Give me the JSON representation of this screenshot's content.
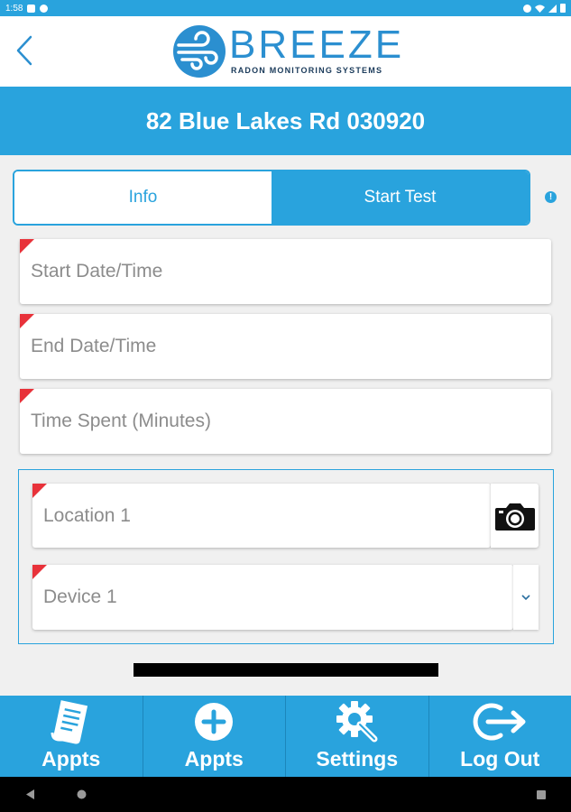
{
  "status_bar": {
    "time": "1:58"
  },
  "header": {
    "logo_word": "BREEZE",
    "logo_subtitle": "RADON MONITORING SYSTEMS"
  },
  "title": "82 Blue Lakes Rd 030920",
  "tabs": [
    {
      "label": "Info",
      "active": false
    },
    {
      "label": "Start Test",
      "active": true
    }
  ],
  "info_badge": "!",
  "fields": {
    "start_datetime": {
      "placeholder": "Start Date/Time",
      "required": true
    },
    "end_datetime": {
      "placeholder": "End Date/Time",
      "required": true
    },
    "time_spent": {
      "placeholder": "Time Spent (Minutes)",
      "required": true
    },
    "location": {
      "placeholder": "Location 1",
      "required": true
    },
    "device": {
      "placeholder": "Device 1",
      "required": true
    }
  },
  "bottom_nav": [
    {
      "label": "Appts",
      "icon": "document-list-icon"
    },
    {
      "label": "Appts",
      "icon": "plus-circle-icon"
    },
    {
      "label": "Settings",
      "icon": "gear-wrench-icon"
    },
    {
      "label": "Log Out",
      "icon": "logout-icon"
    }
  ],
  "colors": {
    "primary": "#29a3dd",
    "required_marker": "#e8323a",
    "placeholder": "#8c8c8c"
  }
}
